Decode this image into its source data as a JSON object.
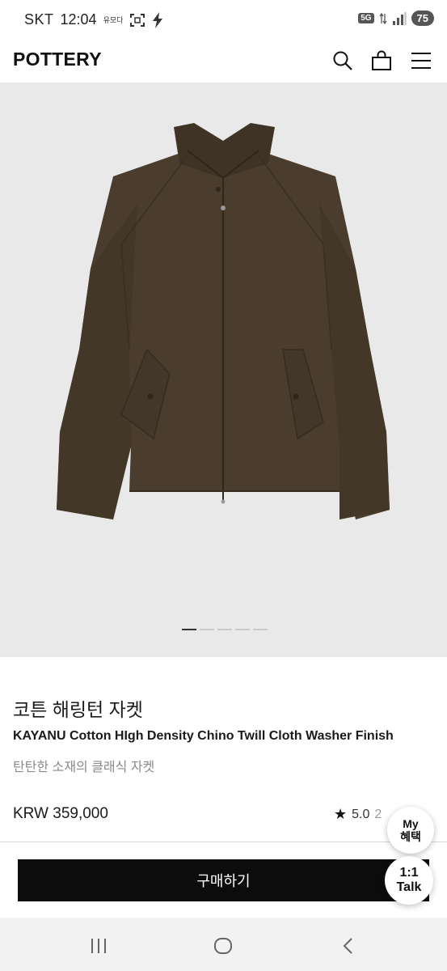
{
  "status_bar": {
    "carrier": "SKT",
    "time": "12:04",
    "extra_icon_text": "유모다",
    "network_badge": "5G",
    "battery": "75"
  },
  "header": {
    "logo": "POTTERY"
  },
  "hero": {
    "slide_count": 5,
    "active_slide": 1,
    "background_color": "#e9e9e9",
    "jacket_color": "#4a3d2d"
  },
  "product": {
    "title_ko": "코튼 해링턴 자켓",
    "title_en": "KAYANU Cotton HIgh Density Chino Twill Cloth Washer Finish",
    "subtitle": "탄탄한 소재의 클래식 자켓",
    "price": "KRW 359,000",
    "rating": "5.0",
    "review_count": "2"
  },
  "actions": {
    "buy_label": "구매하기"
  },
  "floating": {
    "my_benefit_line1": "My",
    "my_benefit_line2": "혜택",
    "talk_line1": "1:1",
    "talk_line2": "Talk"
  }
}
